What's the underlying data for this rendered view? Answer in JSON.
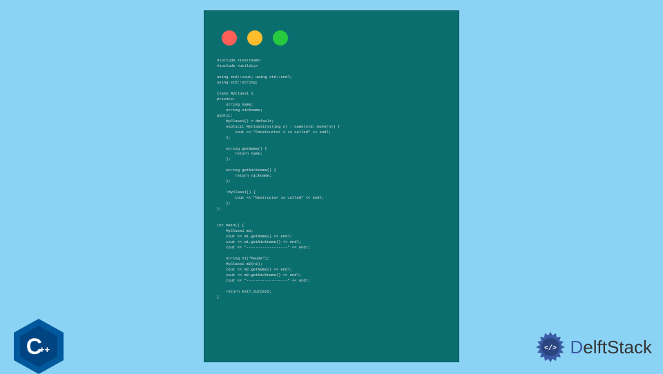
{
  "window": {
    "dots": [
      "red",
      "yellow",
      "green"
    ]
  },
  "code": {
    "lines": "#include <iostream>\n#include <utility>\n\nusing std::cout; using std::endl;\nusing std::string;\n\nclass MyClass1 {\nprivate:\n    string name;\n    string nickname;\npublic:\n    MyClass1() = default;\n    explicit MyClass1(string n) : name(std::move(n)) {\n        cout << \"Constructor 1 is called\" << endl;\n    };\n\n    string getName() {\n        return name;\n    };\n\n    string getNickname() {\n        return nickname;\n    };\n\n    ~MyClass1() {\n        cout << \"Destructor is called\" << endl;\n    };\n};\n\n\nint main() {\n    MyClass1 m1;\n    cout << m1.getName() << endl;\n    cout << m1.getNickname() << endl;\n    cout << \"------------------\" << endl;\n\n    string n1(\"Maude\");\n    MyClass1 m2(n1);\n    cout << m2.getName() << endl;\n    cout << m2.getNickname() << endl;\n    cout << \"------------------\" << endl;\n\n    return EXIT_SUCCESS;\n}"
  },
  "cpp_logo": {
    "text_c": "C",
    "text_plus": "++"
  },
  "delft": {
    "text_d": "D",
    "text_rest": "elftStack"
  }
}
